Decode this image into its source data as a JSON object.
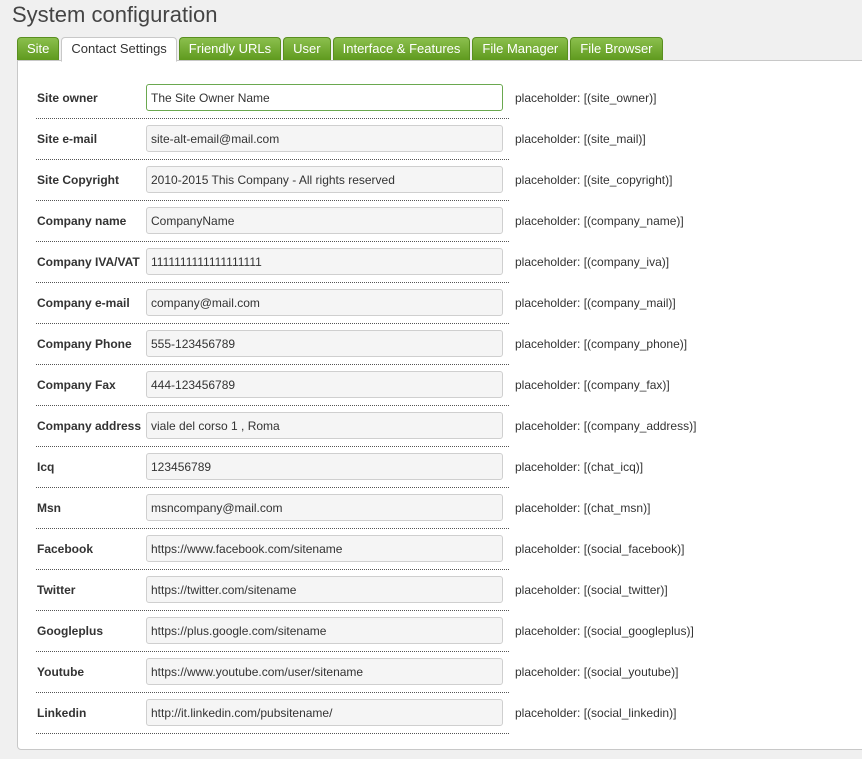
{
  "page": {
    "title": "System configuration"
  },
  "tabs": [
    {
      "label": "Site",
      "active": false
    },
    {
      "label": "Contact Settings",
      "active": true
    },
    {
      "label": "Friendly URLs",
      "active": false
    },
    {
      "label": "User",
      "active": false
    },
    {
      "label": "Interface & Features",
      "active": false
    },
    {
      "label": "File Manager",
      "active": false
    },
    {
      "label": "File Browser",
      "active": false
    }
  ],
  "fields": [
    {
      "label": "Site owner",
      "value": "The Site Owner Name",
      "hint": "placeholder: [(site_owner)]",
      "focused": true
    },
    {
      "label": "Site e-mail",
      "value": "site-alt-email@mail.com",
      "hint": "placeholder: [(site_mail)]"
    },
    {
      "label": "Site Copyright",
      "value": "2010-2015 This Company - All rights reserved",
      "hint": "placeholder: [(site_copyright)]"
    },
    {
      "label": "Company name",
      "value": "CompanyName",
      "hint": "placeholder: [(company_name)]"
    },
    {
      "label": "Company IVA/VAT",
      "value": "1111111111111111111",
      "hint": "placeholder: [(company_iva)]"
    },
    {
      "label": "Company e-mail",
      "value": "company@mail.com",
      "hint": "placeholder: [(company_mail)]"
    },
    {
      "label": "Company Phone",
      "value": "555-123456789",
      "hint": "placeholder: [(company_phone)]"
    },
    {
      "label": "Company Fax",
      "value": "444-123456789",
      "hint": "placeholder: [(company_fax)]"
    },
    {
      "label": "Company address",
      "value": "viale del corso 1 , Roma",
      "hint": "placeholder: [(company_address)]"
    },
    {
      "label": "Icq",
      "value": "123456789",
      "hint": "placeholder: [(chat_icq)]"
    },
    {
      "label": "Msn",
      "value": "msncompany@mail.com",
      "hint": "placeholder: [(chat_msn)]"
    },
    {
      "label": "Facebook",
      "value": "https://www.facebook.com/sitename",
      "hint": "placeholder: [(social_facebook)]"
    },
    {
      "label": "Twitter",
      "value": "https://twitter.com/sitename",
      "hint": "placeholder: [(social_twitter)]"
    },
    {
      "label": "Googleplus",
      "value": "https://plus.google.com/sitename",
      "hint": "placeholder: [(social_googleplus)]"
    },
    {
      "label": "Youtube",
      "value": "https://www.youtube.com/user/sitename",
      "hint": "placeholder: [(social_youtube)]"
    },
    {
      "label": "Linkedin",
      "value": "http://it.linkedin.com/pubsitename/",
      "hint": "placeholder: [(social_linkedin)]"
    }
  ],
  "colors": {
    "tab_green": "#6aa22d",
    "focus_border": "#6aa84f"
  }
}
